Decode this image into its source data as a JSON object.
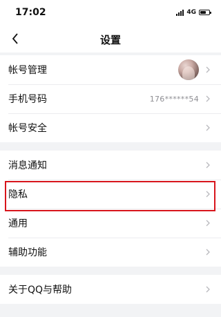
{
  "status_bar": {
    "time": "17:02",
    "network": "4G",
    "battery_level": 0.6
  },
  "nav": {
    "title": "设置",
    "back_icon": "chevron-left-icon"
  },
  "account_group": {
    "account_management": "帐号管理",
    "phone_label": "手机号码",
    "phone_value": "176******54",
    "account_security": "帐号安全"
  },
  "general_group": {
    "notifications": "消息通知",
    "privacy": "隐私",
    "general": "通用",
    "accessibility": "辅助功能"
  },
  "about_group": {
    "about": "关于QQ与帮助"
  },
  "colors": {
    "highlight": "#d8141b",
    "background": "#f2f3f5"
  }
}
